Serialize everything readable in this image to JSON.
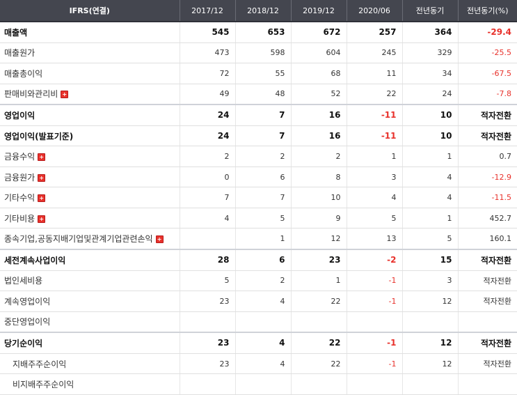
{
  "headers": [
    "IFRS(연결)",
    "2017/12",
    "2018/12",
    "2019/12",
    "2020/06",
    "전년동기",
    "전년동기(%)"
  ],
  "rows": [
    {
      "label": "매출액",
      "values": [
        "545",
        "653",
        "672",
        "257",
        "364",
        "-29.4"
      ]
    },
    {
      "label": "매출원가",
      "values": [
        "473",
        "598",
        "604",
        "245",
        "329",
        "-25.5"
      ]
    },
    {
      "label": "매출총이익",
      "values": [
        "72",
        "55",
        "68",
        "11",
        "34",
        "-67.5"
      ]
    },
    {
      "label": "판매비와관리비",
      "expand_icon": "plus-icon",
      "values": [
        "49",
        "48",
        "52",
        "22",
        "24",
        "-7.8"
      ]
    },
    {
      "label": "영업이익",
      "values": [
        "24",
        "7",
        "16",
        "-11",
        "10",
        "적자전환"
      ]
    },
    {
      "label": "영업이익(발표기준)",
      "values": [
        "24",
        "7",
        "16",
        "-11",
        "10",
        "적자전환"
      ]
    },
    {
      "label": "금융수익",
      "expand_icon": "plus-icon",
      "values": [
        "2",
        "2",
        "2",
        "1",
        "1",
        "0.7"
      ]
    },
    {
      "label": "금융원가",
      "expand_icon": "plus-icon",
      "values": [
        "0",
        "6",
        "8",
        "3",
        "4",
        "-12.9"
      ]
    },
    {
      "label": "기타수익",
      "expand_icon": "plus-icon",
      "values": [
        "7",
        "7",
        "10",
        "4",
        "4",
        "-11.5"
      ]
    },
    {
      "label": "기타비용",
      "expand_icon": "plus-icon",
      "values": [
        "4",
        "5",
        "9",
        "5",
        "1",
        "452.7"
      ]
    },
    {
      "label": "종속기업,공동지배기업및관계기업관련손익",
      "expand_icon": "plus-icon",
      "values": [
        "",
        "1",
        "12",
        "13",
        "5",
        "160.1"
      ]
    },
    {
      "label": "세전계속사업이익",
      "values": [
        "28",
        "6",
        "23",
        "-2",
        "15",
        "적자전환"
      ]
    },
    {
      "label": "법인세비용",
      "values": [
        "5",
        "2",
        "1",
        "-1",
        "3",
        "적자전환"
      ]
    },
    {
      "label": "계속영업이익",
      "values": [
        "23",
        "4",
        "22",
        "-1",
        "12",
        "적자전환"
      ]
    },
    {
      "label": "중단영업이익",
      "values": [
        "",
        "",
        "",
        "",
        "",
        ""
      ]
    },
    {
      "label": "당기순이익",
      "values": [
        "23",
        "4",
        "22",
        "-1",
        "12",
        "적자전환"
      ]
    },
    {
      "label": "지배주주순이익",
      "values": [
        "23",
        "4",
        "22",
        "-1",
        "12",
        "적자전환"
      ]
    },
    {
      "label": "비지배주주순이익",
      "values": [
        "",
        "",
        "",
        "",
        "",
        ""
      ]
    }
  ],
  "colors": {
    "header_bg": "#44464f",
    "negative": "#e8312b",
    "plus_icon": "#e8312b"
  }
}
